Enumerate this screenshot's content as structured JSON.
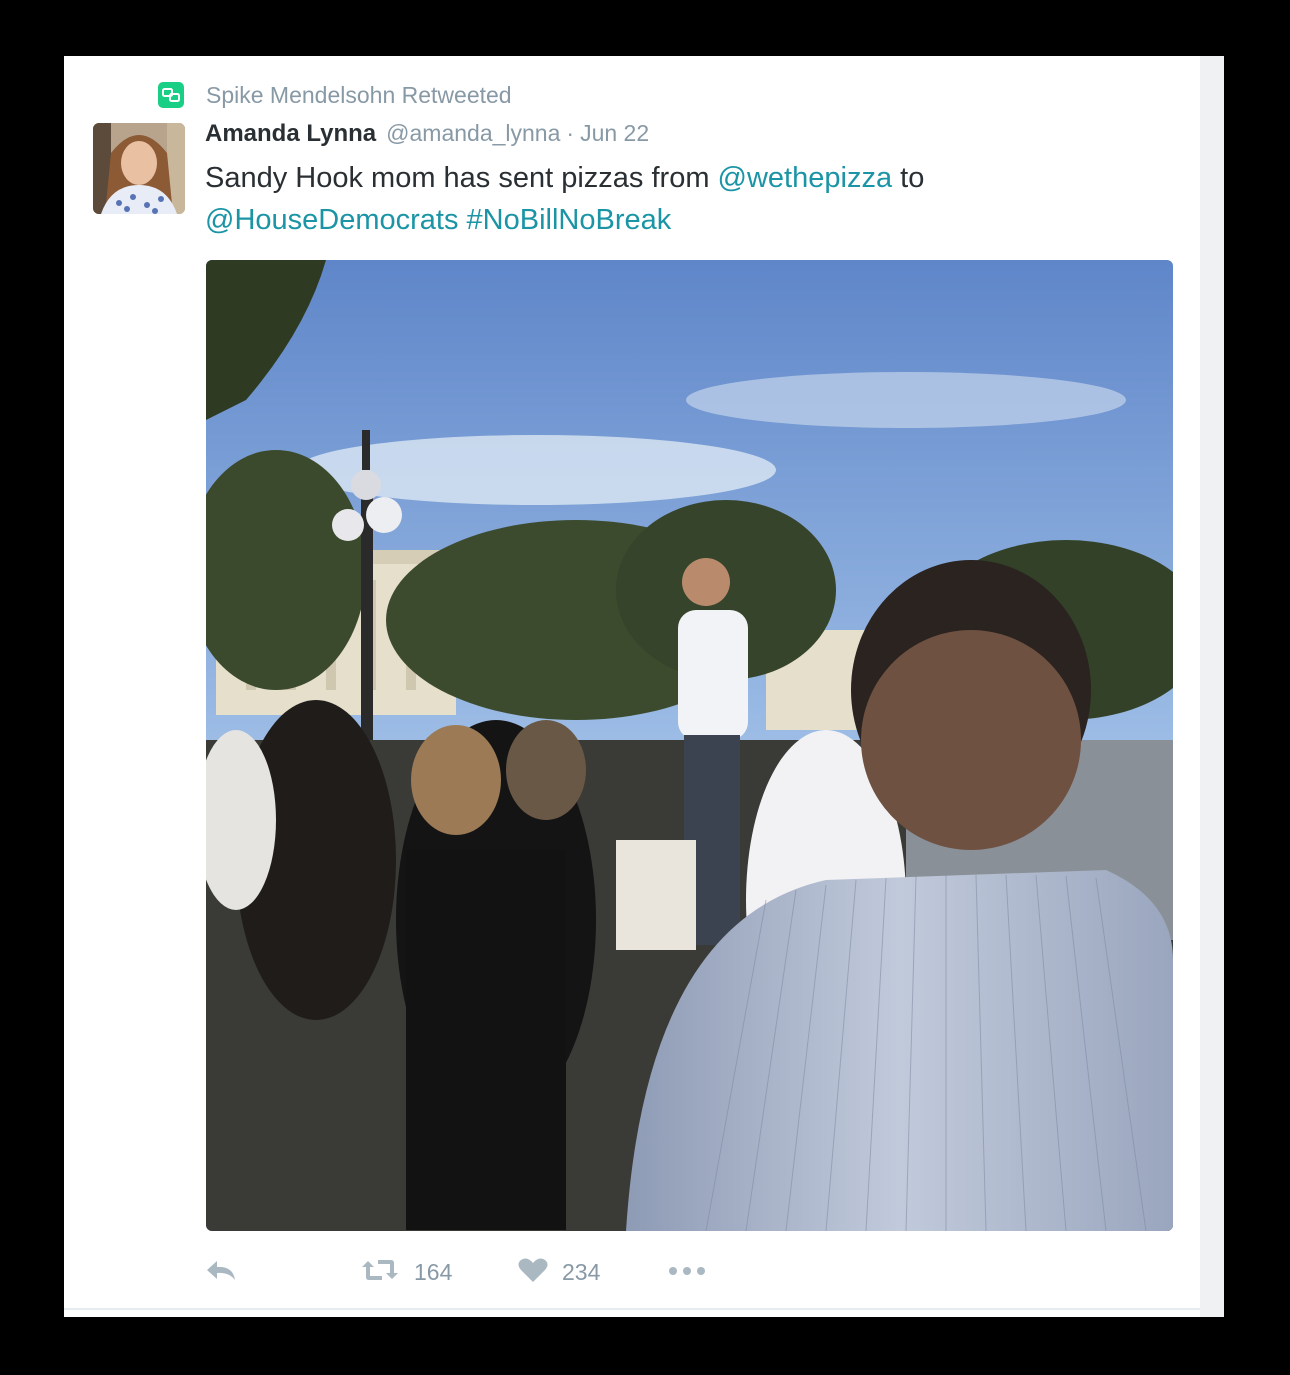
{
  "retweet_context": {
    "text": "Spike Mendelsohn Retweeted"
  },
  "tweet": {
    "display_name": "Amanda Lynna",
    "handle": "@amanda_lynna",
    "separator": "·",
    "date": "Jun 22",
    "text": {
      "part1": "Sandy Hook mom has sent pizzas from ",
      "mention1": "@wethepizza",
      "part2": " to",
      "mention2": "@HouseDemocrats",
      "space": " ",
      "hashtag": "#NoBillNoBreak"
    }
  },
  "actions": {
    "reply_icon": "reply-icon",
    "retweet_icon": "retweet-icon",
    "retweet_count": "164",
    "like_icon": "heart-icon",
    "like_count": "234",
    "more_icon": "more-dots-icon"
  },
  "colors": {
    "link": "#1b95a6",
    "retweet_badge": "#19cf86",
    "muted": "#8899a6",
    "text": "#292f33"
  }
}
